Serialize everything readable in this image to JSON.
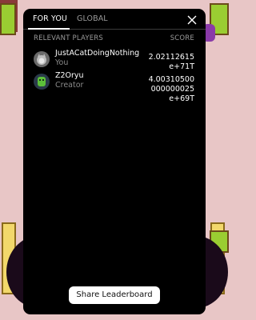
{
  "tabs": [
    {
      "label": "FOR YOU",
      "active": true
    },
    {
      "label": "GLOBAL",
      "active": false
    }
  ],
  "headers": {
    "players": "RELEVANT PLAYERS",
    "score": "SCORE"
  },
  "players": [
    {
      "name": "JustACatDoingNothing",
      "role": "You",
      "score": "2.02112615e+71T",
      "avatar": "cat-photo-avatar"
    },
    {
      "name": "Z2Oryu",
      "role": "Creator",
      "score": "4.00310500000000025e+69T",
      "avatar": "green-character-avatar"
    }
  ],
  "share_button": "Share Leaderboard",
  "icons": {
    "close": "close-icon"
  },
  "colors": {
    "modal_bg": "#000000",
    "muted_text": "#9a9a9a",
    "button_bg": "#ffffff"
  }
}
